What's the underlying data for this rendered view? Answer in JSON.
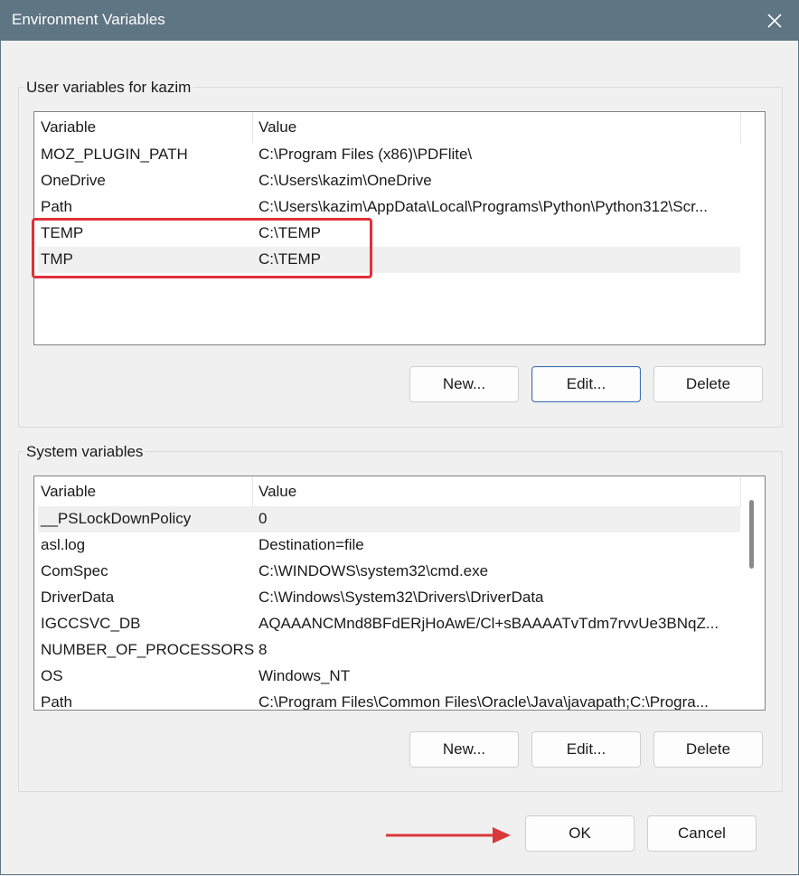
{
  "window": {
    "title": "Environment Variables"
  },
  "user_vars": {
    "group_title": "User variables for kazim",
    "columns": [
      "Variable",
      "Value"
    ],
    "rows": [
      {
        "name": "MOZ_PLUGIN_PATH",
        "value": "C:\\Program Files (x86)\\PDFlite\\"
      },
      {
        "name": "OneDrive",
        "value": "C:\\Users\\kazim\\OneDrive"
      },
      {
        "name": "Path",
        "value": "C:\\Users\\kazim\\AppData\\Local\\Programs\\Python\\Python312\\Scr..."
      },
      {
        "name": "TEMP",
        "value": "C:\\TEMP"
      },
      {
        "name": "TMP",
        "value": "C:\\TEMP"
      }
    ],
    "buttons": {
      "new": "New...",
      "edit": "Edit...",
      "delete": "Delete"
    }
  },
  "system_vars": {
    "group_title": "System variables",
    "columns": [
      "Variable",
      "Value"
    ],
    "rows": [
      {
        "name": "__PSLockDownPolicy",
        "value": "0"
      },
      {
        "name": "asl.log",
        "value": "Destination=file"
      },
      {
        "name": "ComSpec",
        "value": "C:\\WINDOWS\\system32\\cmd.exe"
      },
      {
        "name": "DriverData",
        "value": "C:\\Windows\\System32\\Drivers\\DriverData"
      },
      {
        "name": "IGCCSVC_DB",
        "value": "AQAAANCMnd8BFdERjHoAwE/Cl+sBAAAATvTdm7rvvUe3BNqZ..."
      },
      {
        "name": "NUMBER_OF_PROCESSORS",
        "value": "8"
      },
      {
        "name": "OS",
        "value": "Windows_NT"
      },
      {
        "name": "Path",
        "value": "C:\\Program Files\\Common Files\\Oracle\\Java\\javapath;C:\\Progra..."
      }
    ],
    "buttons": {
      "new": "New...",
      "edit": "Edit...",
      "delete": "Delete"
    }
  },
  "footer": {
    "ok": "OK",
    "cancel": "Cancel"
  },
  "colors": {
    "titlebar": "#5e7584",
    "highlight_box": "#e0303a",
    "arrow": "#d9383a"
  }
}
